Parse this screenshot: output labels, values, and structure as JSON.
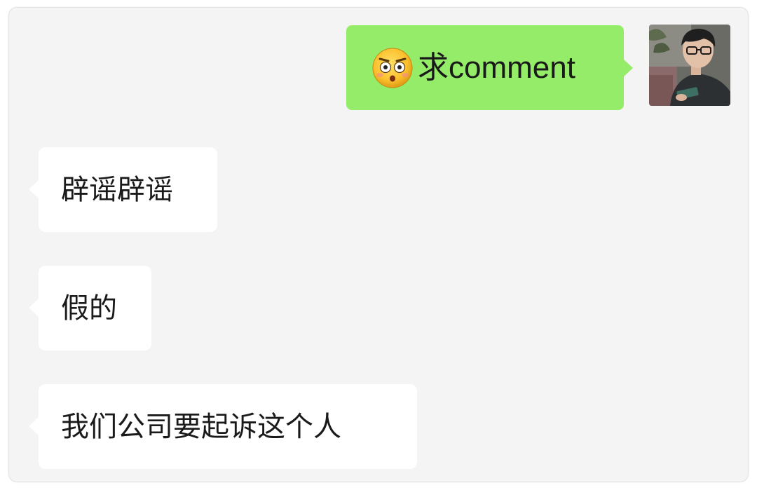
{
  "messages": [
    {
      "direction": "outgoing",
      "emoji": "flushed-face-emoji",
      "text": "求comment"
    },
    {
      "direction": "incoming",
      "text": "辟谣辟谣"
    },
    {
      "direction": "incoming",
      "text": "假的"
    },
    {
      "direction": "incoming",
      "text": "我们公司要起诉这个人"
    }
  ],
  "colors": {
    "outgoing_bubble": "#95ec69",
    "incoming_bubble": "#ffffff",
    "chat_background": "#f4f4f4",
    "text": "#1a1a1a"
  },
  "icons": {
    "emoji": "flushed-face-emoji",
    "avatar": "user-avatar"
  }
}
